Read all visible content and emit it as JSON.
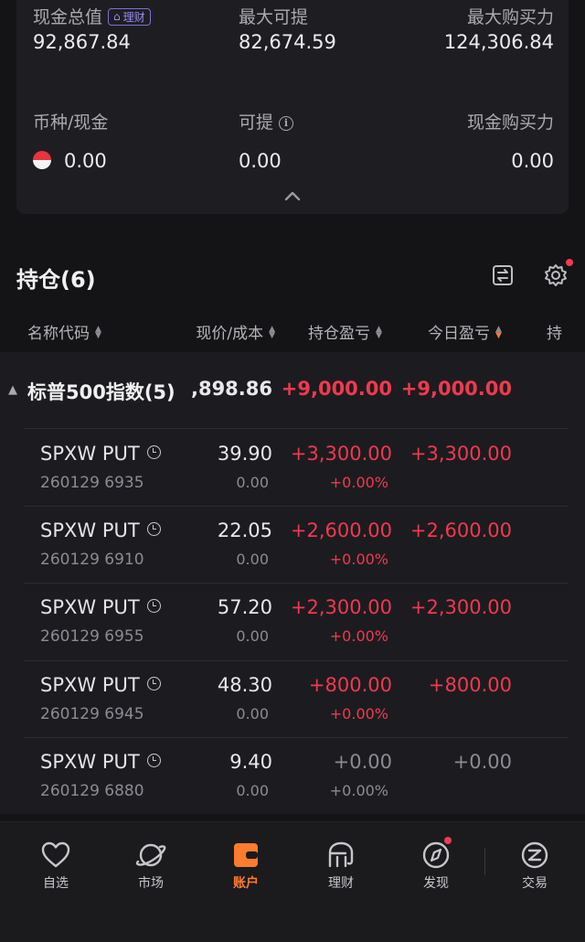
{
  "summary": {
    "cash_total_label": "现金总值",
    "wealth_tag": "理财",
    "cash_total": "92,867.84",
    "max_withdraw_label": "最大可提",
    "max_withdraw": "82,674.59",
    "max_buying_label": "最大购买力",
    "max_buying": "124,306.84",
    "currency_cash_label": "币种/现金",
    "currency_cash": "0.00",
    "withdrawable_label": "可提",
    "withdrawable": "0.00",
    "cash_buying_label": "现金购买力",
    "cash_buying": "0.00"
  },
  "positions": {
    "title": "持仓(6)",
    "columns": {
      "name": "名称代码",
      "price_cost": "现价/成本",
      "pnl": "持仓盈亏",
      "today": "今日盈亏",
      "more": "持"
    },
    "group": {
      "name": "标普500指数(5)",
      "price": ",898.86",
      "pnl": "+9,000.00",
      "today": "+9,000.00"
    },
    "rows": [
      {
        "name": "SPXW PUT",
        "code": "260129 6935",
        "price": "39.90",
        "cost": "0.00",
        "pnl": "+3,300.00",
        "pnl_pct": "+0.00%",
        "today": "+3,300.00"
      },
      {
        "name": "SPXW PUT",
        "code": "260129 6910",
        "price": "22.05",
        "cost": "0.00",
        "pnl": "+2,600.00",
        "pnl_pct": "+0.00%",
        "today": "+2,600.00"
      },
      {
        "name": "SPXW PUT",
        "code": "260129 6955",
        "price": "57.20",
        "cost": "0.00",
        "pnl": "+2,300.00",
        "pnl_pct": "+0.00%",
        "today": "+2,300.00"
      },
      {
        "name": "SPXW PUT",
        "code": "260129 6945",
        "price": "48.30",
        "cost": "0.00",
        "pnl": "+800.00",
        "pnl_pct": "+0.00%",
        "today": "+800.00"
      },
      {
        "name": "SPXW PUT",
        "code": "260129 6880",
        "price": "9.40",
        "cost": "0.00",
        "pnl": "+0.00",
        "pnl_pct": "+0.00%",
        "today": "+0.00"
      }
    ]
  },
  "tabbar": {
    "favorites": "自选",
    "market": "市场",
    "account": "账户",
    "wealth": "理财",
    "discover": "发现",
    "trade": "交易"
  },
  "colors": {
    "accent": "#ff7b2e",
    "profit": "#f0394f",
    "neutral": "#8b8b93"
  }
}
